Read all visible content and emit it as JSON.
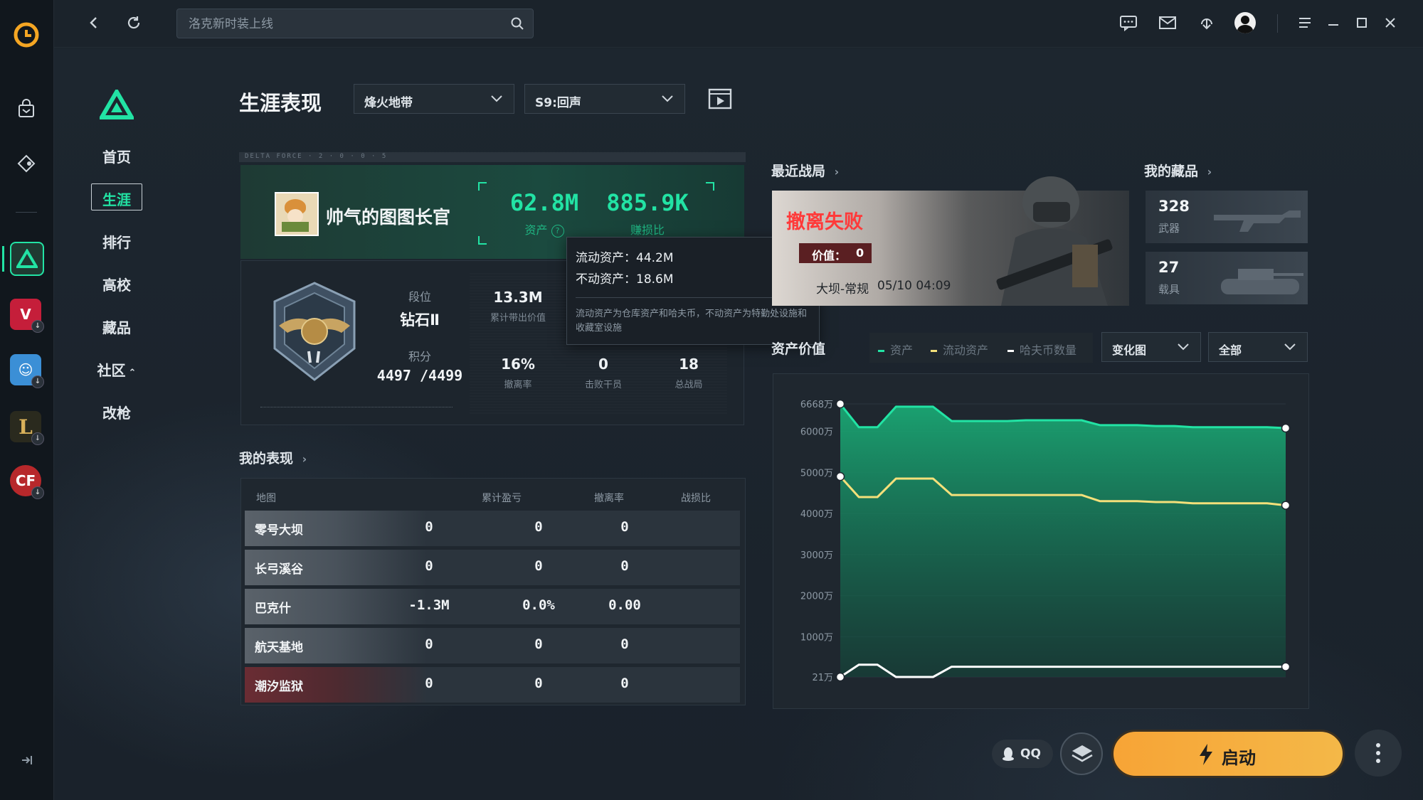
{
  "search": {
    "placeholder": "洛克新时装上线"
  },
  "nav": {
    "items": [
      {
        "label": "首页"
      },
      {
        "label": "生涯",
        "active": true
      },
      {
        "label": "排行"
      },
      {
        "label": "高校"
      },
      {
        "label": "藏品"
      },
      {
        "label": "社区"
      },
      {
        "label": "改枪"
      }
    ]
  },
  "page": {
    "title": "生涯表现",
    "mode_select": "烽火地带",
    "season_select": "S9:回声",
    "banner_code": "DELTA FORCE · 2 · 0 · 0 · 5"
  },
  "profile": {
    "name": "帅气的图图长官",
    "assets_value": "62.8M",
    "assets_label": "资产",
    "profit_value": "885.9K",
    "profit_label": "赚损比",
    "rank_label": "段位",
    "rank_value": "钻石Ⅱ",
    "points_label": "积分",
    "points_value": "4497 /4499",
    "stats": [
      {
        "value": "13.3M",
        "label": "累计带出价值"
      },
      {
        "value": "16%",
        "label": "撤离率"
      },
      {
        "value": "0",
        "label": "击败干员"
      },
      {
        "value": "18",
        "label": "总战局"
      }
    ]
  },
  "tooltip": {
    "liquid": "流动资产：44.2M",
    "fixed": "不动资产：18.6M",
    "note": "流动资产为仓库资产和哈夫币，不动资产为特勤处设施和收藏室设施"
  },
  "performance": {
    "title": "我的表现",
    "headers": [
      "地图",
      "累计盈亏",
      "撤离率",
      "战损比"
    ],
    "rows": [
      {
        "map": "零号大坝",
        "profit": "0",
        "rate": "0",
        "kd": "0"
      },
      {
        "map": "长弓溪谷",
        "profit": "0",
        "rate": "0",
        "kd": "0"
      },
      {
        "map": "巴克什",
        "profit": "-1.3M",
        "rate": "0.0%",
        "kd": "0.00"
      },
      {
        "map": "航天基地",
        "profit": "0",
        "rate": "0",
        "kd": "0"
      },
      {
        "map": "潮汐监狱",
        "profit": "0",
        "rate": "0",
        "kd": "0"
      }
    ]
  },
  "recent": {
    "title": "最近战局",
    "result": "撤离失败",
    "value_label": "价值：",
    "value": "0",
    "map": "大坝-常规",
    "time": "05/10 04:09"
  },
  "collection": {
    "title": "我的藏品",
    "items": [
      {
        "count": "328",
        "label": "武器"
      },
      {
        "count": "27",
        "label": "载具"
      }
    ]
  },
  "asset_chart": {
    "title": "资产价值",
    "legend": [
      "资产",
      "流动资产",
      "哈夫币数量"
    ],
    "view_select": "变化图",
    "range_select": "全部"
  },
  "chart_data": {
    "type": "line",
    "title": "资产价值",
    "yticks": [
      "6668万",
      "6000万",
      "5000万",
      "4000万",
      "3000万",
      "2000万",
      "1000万",
      "21万"
    ],
    "ylim": [
      21,
      6668
    ],
    "series": [
      {
        "name": "资产",
        "color": "#22e3a4",
        "values": [
          6668,
          6100,
          6100,
          6600,
          6600,
          6600,
          6250,
          6250,
          6250,
          6250,
          6270,
          6270,
          6270,
          6270,
          6150,
          6150,
          6150,
          6130,
          6130,
          6100,
          6100,
          6100,
          6100,
          6100,
          6080
        ]
      },
      {
        "name": "流动资产",
        "color": "#f4e07a",
        "values": [
          4900,
          4400,
          4400,
          4850,
          4850,
          4850,
          4450,
          4450,
          4450,
          4450,
          4450,
          4450,
          4450,
          4450,
          4300,
          4300,
          4300,
          4280,
          4280,
          4250,
          4250,
          4250,
          4250,
          4250,
          4200
        ]
      },
      {
        "name": "哈夫币数量",
        "color": "#ffffff",
        "values": [
          21,
          320,
          320,
          21,
          21,
          21,
          270,
          270,
          270,
          270,
          270,
          270,
          270,
          270,
          270,
          270,
          270,
          270,
          270,
          270,
          270,
          270,
          270,
          270,
          270
        ]
      }
    ]
  },
  "bottom": {
    "qq_label": "QQ",
    "launch_label": "启动"
  },
  "colors": {
    "accent": "#22e3a4",
    "fail": "#ff3a3a",
    "launch": "#f7a436"
  }
}
